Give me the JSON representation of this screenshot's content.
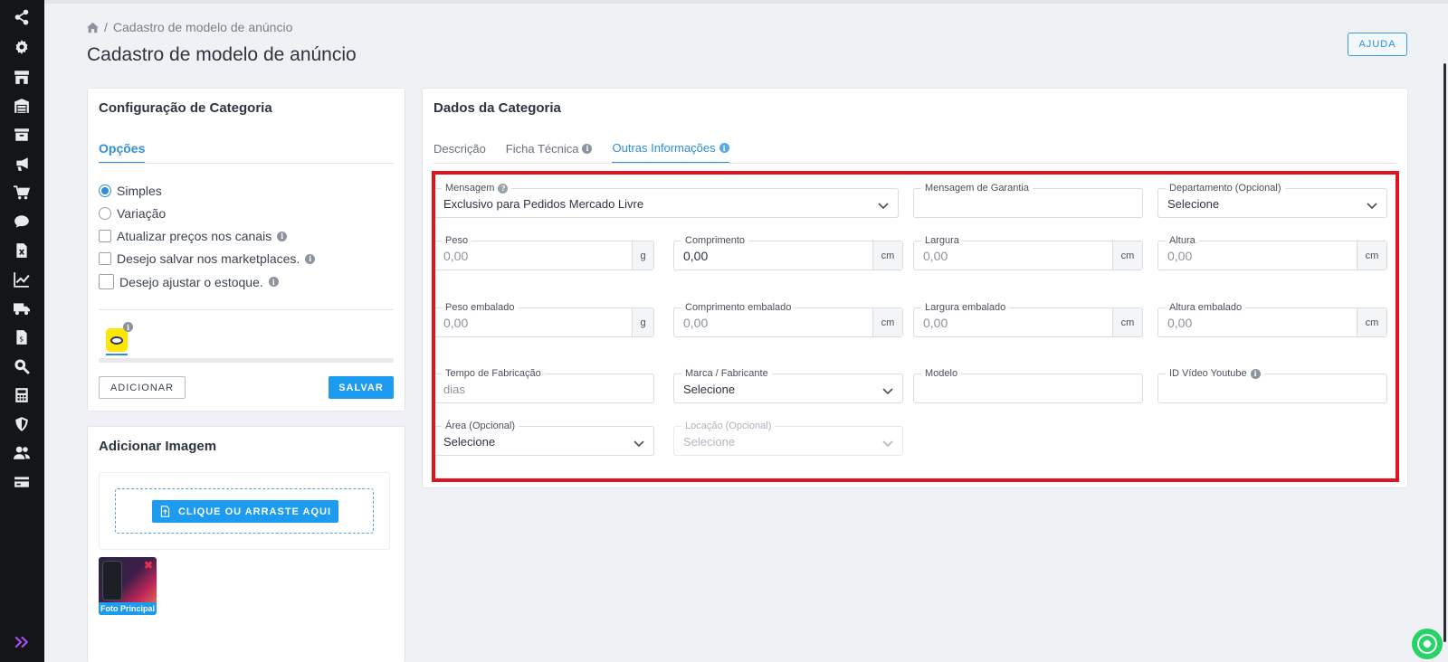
{
  "sidebar": {
    "icons": [
      "share-icon",
      "gear-icon",
      "store-icon",
      "warehouse-icon",
      "archive-icon",
      "megaphone-icon",
      "cart-icon",
      "chat-icon",
      "excel-file-icon",
      "chart-line-icon",
      "truck-icon",
      "invoice-icon",
      "search-zoom-icon",
      "calculator-icon",
      "shield-icon",
      "users-icon",
      "credit-card-icon"
    ],
    "expand_icon": "double-chevron-right-icon",
    "accent": "#a64ff0"
  },
  "header": {
    "breadcrumb": "Cadastro de modelo de anúncio",
    "title": "Cadastro de modelo de anúncio",
    "help_label": "AJUDA"
  },
  "config": {
    "title": "Configuração de Categoria",
    "tab": "Opções",
    "radio_simples": "Simples",
    "radio_variacao": "Variação",
    "chk_precos": "Atualizar preços nos canais",
    "chk_marketplaces": "Desejo salvar nos marketplaces.",
    "chk_estoque": "Desejo ajustar o estoque.",
    "marketplace_logo_text": "mercado livre",
    "add_label": "ADICIONAR",
    "save_label": "SALVAR"
  },
  "image": {
    "title": "Adicionar Imagem",
    "upload_label": "CLIQUE OU ARRASTE AQUI",
    "thumb_label": "Foto Principal"
  },
  "data": {
    "title": "Dados da Categoria",
    "tabs": [
      "Descrição",
      "Ficha Técnica",
      "Outras Informações"
    ],
    "fields": {
      "mensagem": {
        "label": "Mensagem",
        "value": "Exclusivo para Pedidos Mercado Livre"
      },
      "garantia": {
        "label": "Mensagem de Garantia",
        "value": ""
      },
      "departamento": {
        "label": "Departamento (Opcional)",
        "value": "Selecione"
      },
      "peso": {
        "label": "Peso",
        "value": "0,00",
        "unit": "g"
      },
      "comprimento": {
        "label": "Comprimento",
        "value": "0,00",
        "unit": "cm"
      },
      "largura": {
        "label": "Largura",
        "value": "0,00",
        "unit": "cm"
      },
      "altura": {
        "label": "Altura",
        "value": "0,00",
        "unit": "cm"
      },
      "peso_emb": {
        "label": "Peso embalado",
        "value": "0,00",
        "unit": "g"
      },
      "comp_emb": {
        "label": "Comprimento embalado",
        "value": "0,00",
        "unit": "cm"
      },
      "larg_emb": {
        "label": "Largura embalado",
        "value": "0,00",
        "unit": "cm"
      },
      "alt_emb": {
        "label": "Altura embalado",
        "value": "0,00",
        "unit": "cm"
      },
      "tempo": {
        "label": "Tempo de Fabricação",
        "value": "dias"
      },
      "marca": {
        "label": "Marca / Fabricante",
        "value": "Selecione"
      },
      "modelo": {
        "label": "Modelo",
        "value": ""
      },
      "video": {
        "label": "ID Vídeo Youtube",
        "value": ""
      },
      "area": {
        "label": "Área (Opcional)",
        "value": "Selecione"
      },
      "locacao": {
        "label": "Locação (Opcional)",
        "value": "Selecione"
      }
    }
  },
  "colors": {
    "primary": "#1d9bf0",
    "highlight": "#e0141e",
    "sidebar": "#141517"
  }
}
